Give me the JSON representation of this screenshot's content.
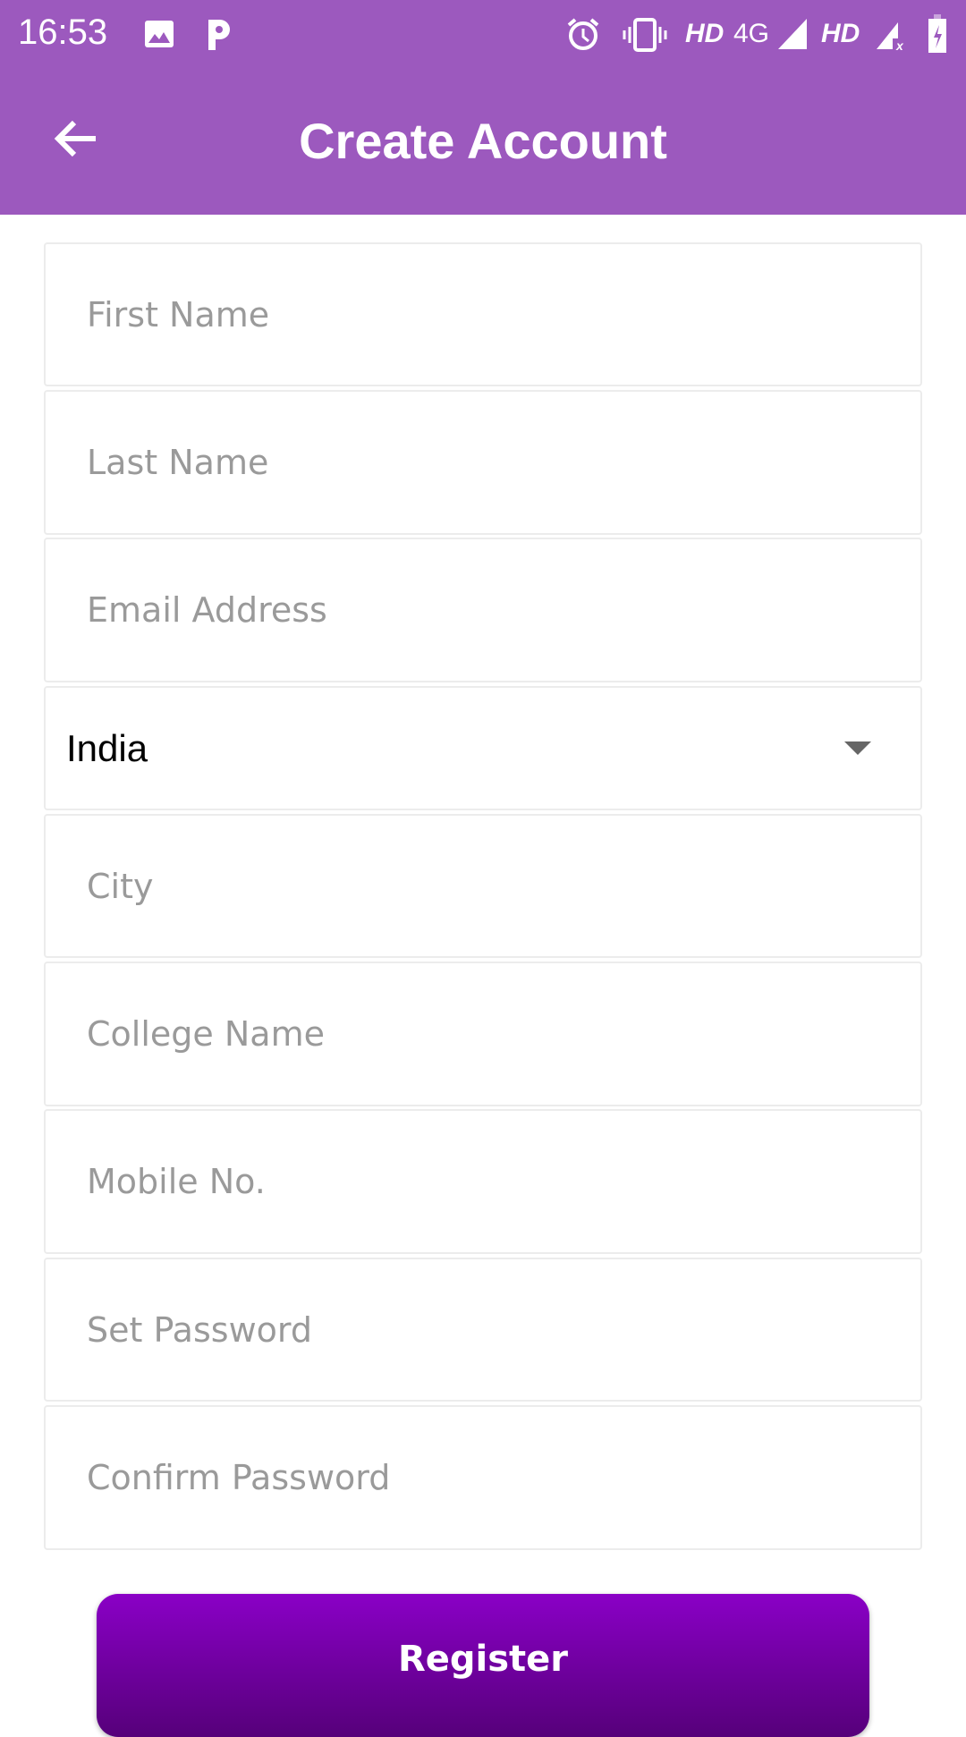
{
  "status_bar": {
    "time": "16:53",
    "network_1": "HD",
    "network_type": "4G",
    "network_2": "HD",
    "icons": [
      "image-icon",
      "p-app-icon",
      "alarm-icon",
      "vibrate-icon",
      "signal-icon",
      "signal-no-sim-icon",
      "battery-charging-icon"
    ]
  },
  "app_bar": {
    "title": "Create Account",
    "back_icon": "arrow-left-icon",
    "color": "#9c59be"
  },
  "form": {
    "first_name": {
      "placeholder": "First Name",
      "value": ""
    },
    "last_name": {
      "placeholder": "Last Name",
      "value": ""
    },
    "email": {
      "placeholder": "Email Address",
      "value": ""
    },
    "country": {
      "selected": "India"
    },
    "city": {
      "placeholder": "City",
      "value": ""
    },
    "college": {
      "placeholder": "College Name",
      "value": ""
    },
    "mobile": {
      "placeholder": "Mobile No.",
      "value": ""
    },
    "password": {
      "placeholder": "Set Password",
      "value": ""
    },
    "confirm_password": {
      "placeholder": "Confirm Password",
      "value": ""
    }
  },
  "register_button": {
    "label": "Register",
    "color": "#7a00b0"
  }
}
